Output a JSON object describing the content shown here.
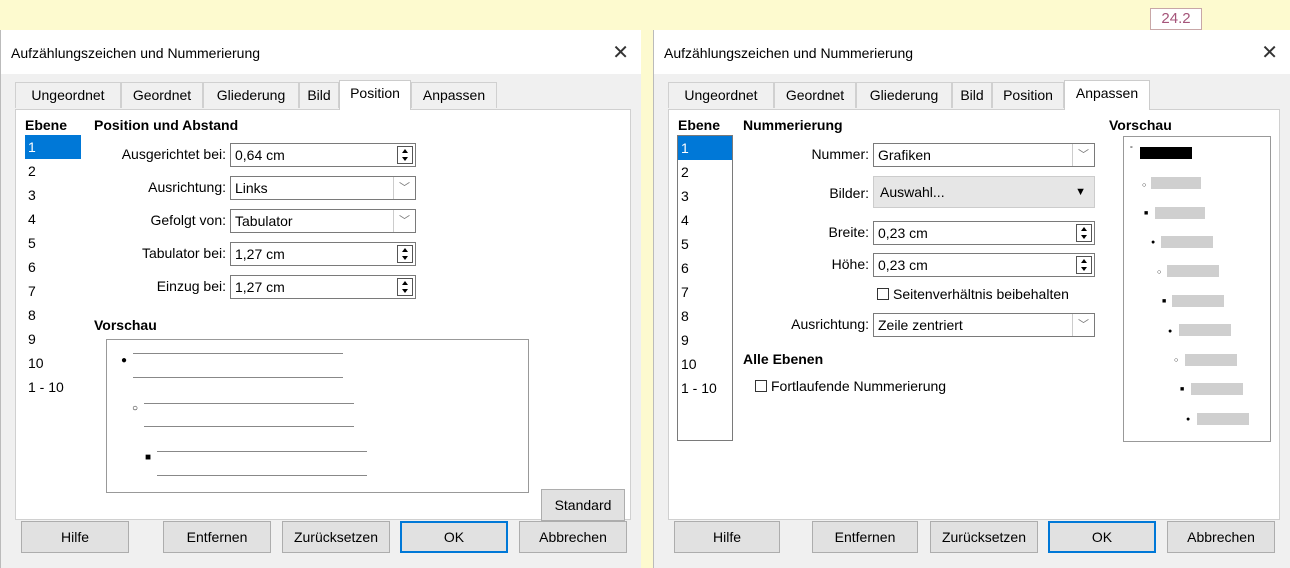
{
  "version_badge": "24.2",
  "left_dialog": {
    "title": "Aufzählungszeichen und Nummerierung",
    "tabs": [
      "Ungeordnet",
      "Geordnet",
      "Gliederung",
      "Bild",
      "Position",
      "Anpassen"
    ],
    "active_tab": "Position",
    "level_header": "Ebene",
    "levels": [
      "1",
      "2",
      "3",
      "4",
      "5",
      "6",
      "7",
      "8",
      "9",
      "10",
      "1 - 10"
    ],
    "selected_level": "1",
    "section_title": "Position und Abstand",
    "aligned_at_label": "Ausgerichtet bei:",
    "aligned_at_value": "0,64 cm",
    "alignment_label": "Ausrichtung:",
    "alignment_value": "Links",
    "followed_by_label": "Gefolgt von:",
    "followed_by_value": "Tabulator",
    "tab_stop_label": "Tabulator bei:",
    "tab_stop_value": "1,27 cm",
    "indent_label": "Einzug bei:",
    "indent_value": "1,27 cm",
    "preview_title": "Vorschau",
    "default_button": "Standard",
    "buttons": {
      "help": "Hilfe",
      "remove": "Entfernen",
      "reset": "Zurücksetzen",
      "ok": "OK",
      "cancel": "Abbrechen"
    }
  },
  "right_dialog": {
    "title": "Aufzählungszeichen und Nummerierung",
    "tabs": [
      "Ungeordnet",
      "Geordnet",
      "Gliederung",
      "Bild",
      "Position",
      "Anpassen"
    ],
    "active_tab": "Anpassen",
    "level_header": "Ebene",
    "levels": [
      "1",
      "2",
      "3",
      "4",
      "5",
      "6",
      "7",
      "8",
      "9",
      "10",
      "1 - 10"
    ],
    "selected_level": "1",
    "section_title": "Nummerierung",
    "number_label": "Nummer:",
    "number_value": "Grafiken",
    "images_label": "Bilder:",
    "images_value": "Auswahl...",
    "width_label": "Breite:",
    "width_value": "0,23 cm",
    "height_label": "Höhe:",
    "height_value": "0,23 cm",
    "keep_ratio_label": "Seitenverhältnis beibehalten",
    "alignment_label": "Ausrichtung:",
    "alignment_value": "Zeile zentriert",
    "all_levels_title": "Alle Ebenen",
    "continuous_label": "Fortlaufende Nummerierung",
    "preview_title": "Vorschau",
    "buttons": {
      "help": "Hilfe",
      "remove": "Entfernen",
      "reset": "Zurücksetzen",
      "ok": "OK",
      "cancel": "Abbrechen"
    }
  }
}
